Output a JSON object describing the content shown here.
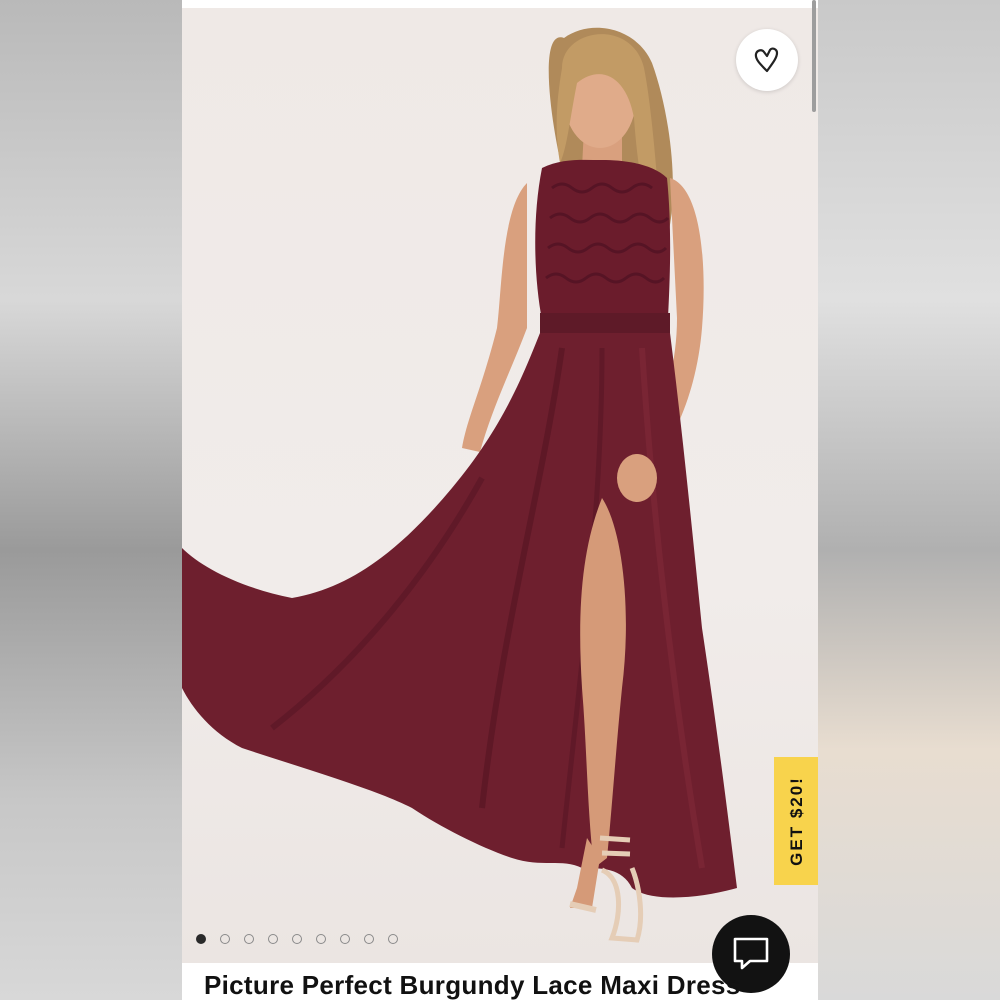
{
  "product": {
    "title": "Picture Perfect Burgundy Lace Maxi Dress",
    "image_count": 9,
    "active_image_index": 0
  },
  "promo": {
    "label": "GET $20!"
  },
  "icons": {
    "favorite": "heart-outline-icon",
    "chat": "chat-bubble-icon"
  },
  "colors": {
    "dress": "#6e1f2e",
    "promo_tab": "#f8d34c",
    "chat_button": "#121212"
  }
}
